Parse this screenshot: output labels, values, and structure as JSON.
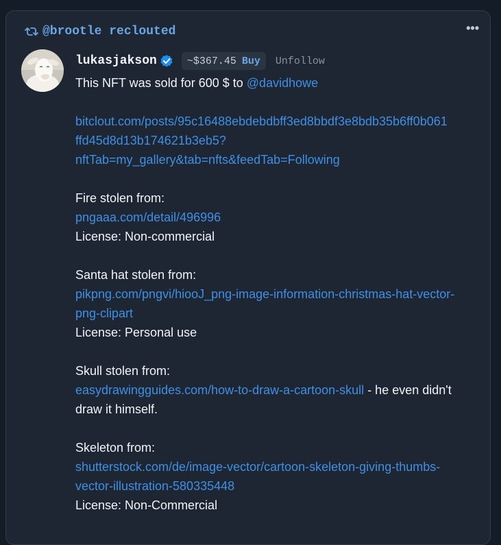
{
  "reclout": {
    "text": "@brootle reclouted"
  },
  "post": {
    "username": "lukasjakson",
    "price": "~$367.45",
    "buy_label": "Buy",
    "unfollow_label": "Unfollow",
    "lines": {
      "intro_prefix": "This NFT was sold for 600 $ to ",
      "intro_mention": "@davidhowe",
      "url1_a": "bitclout.com/posts/95c16488ebdebdbff3ed8bbdf3e8bdb35b6ff0b061",
      "url1_b": "ffd45d8d13b174621b3eb5?",
      "url1_c": "nftTab=my_gallery&tab=nfts&feedTab=Following",
      "fire_label": "Fire stolen from:",
      "fire_link": "pngaaa.com/detail/496996",
      "fire_license": "License: Non-commercial",
      "santa_label": "Santa hat stolen from:",
      "santa_link_a": "pikpng.com/pngvi/hiooJ_png-image-information-christmas-hat-vector-",
      "santa_link_b": "png-clipart",
      "santa_license": "License: Personal use",
      "skull_label": "Skull stolen from:",
      "skull_link": "easydrawingguides.com/how-to-draw-a-cartoon-skull",
      "skull_suffix": " - he even didn't",
      "skull_suffix2": "draw it himself.",
      "skeleton_label": "Skeleton from:",
      "skeleton_link_a": "shutterstock.com/de/image-vector/cartoon-skeleton-giving-thumbs-",
      "skeleton_link_b": "vector-illustration-580335448",
      "skeleton_license": "License: Non-Commercial"
    }
  },
  "icons": {
    "reclout": "reclout-icon",
    "verified": "verified-icon",
    "more": "more-icon",
    "avatar": "goat-avatar"
  },
  "colors": {
    "background": "#131c27",
    "card": "#1d2632",
    "link": "#3f8fe4",
    "accent": "#6aa6e6",
    "verified": "#1d8df0"
  }
}
